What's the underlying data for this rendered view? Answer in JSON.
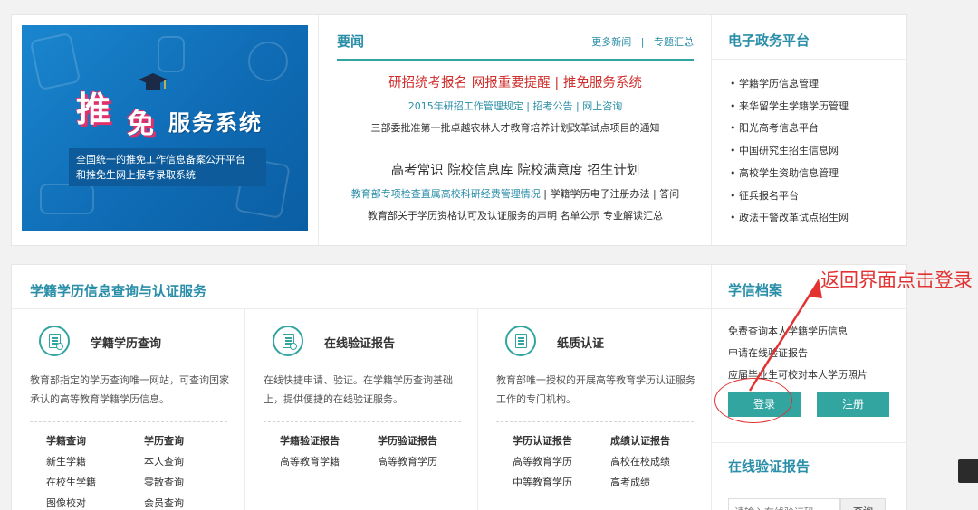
{
  "banner": {
    "title_tui": "推",
    "title_mian": "免",
    "title_system": "服务系统",
    "desc_line1": "全国统一的推免工作信息备案公开平台",
    "desc_line2": "和推免生网上报考录取系统"
  },
  "news": {
    "title": "要闻",
    "more_news": "更多新闻",
    "separator": "|",
    "topics": "专题汇总",
    "headline1": "研招统考报名  网报重要提醒 | 推免服务系统",
    "subline1": "2015年研招工作管理规定 | 招考公告 | 网上咨询",
    "subline2": "三部委批准第一批卓越农林人才教育培养计划改革试点项目的通知",
    "headline2": "高考常识  院校信息库  院校满意度  招生计划",
    "subline3_blue": "教育部专项检查直属高校科研经费管理情况",
    "subline3_rest": " | 学籍学历电子注册办法 | 答问",
    "subline4": "教育部关于学历资格认可及认证服务的声明  名单公示  专业解读汇总"
  },
  "platform": {
    "title": "电子政务平台",
    "items": [
      "学籍学历信息管理",
      "来华留学生学籍学历管理",
      "阳光高考信息平台",
      "中国研究生招生信息网",
      "高校学生资助信息管理",
      "征兵报名平台",
      "政法干警改革试点招生网"
    ]
  },
  "services": {
    "title": "学籍学历信息查询与认证服务",
    "columns": [
      {
        "title": "学籍学历查询",
        "desc": "教育部指定的学历查询唯一网站，可查询国家承认的高等教育学籍学历信息。",
        "links": [
          "学籍查询",
          "学历查询",
          "新生学籍",
          "本人查询",
          "在校生学籍",
          "零散查询",
          "图像校对",
          "会员查询"
        ]
      },
      {
        "title": "在线验证报告",
        "desc": "在线快捷申请、验证。在学籍学历查询基础上，提供便捷的在线验证服务。",
        "links": [
          "学籍验证报告",
          "学历验证报告",
          "高等教育学籍",
          "高等教育学历"
        ]
      },
      {
        "title": "纸质认证",
        "desc": "教育部唯一授权的开展高等教育学历认证服务工作的专门机构。",
        "links": [
          "学历认证报告",
          "成绩认证报告",
          "高等教育学历",
          "高校在校成绩",
          "中等教育学历",
          "高考成绩"
        ]
      }
    ]
  },
  "archive": {
    "title": "学信档案",
    "items": [
      "免费查询本人学籍学历信息",
      "申请在线验证报告",
      "应届毕业生可校对本人学历照片"
    ],
    "login": "登录",
    "register": "注册",
    "verify_title": "在线验证报告",
    "verify_placeholder": "请输入在线验证码",
    "verify_button": "查询"
  },
  "annotation": {
    "text": "返回界面点击登录",
    "color": "#e23232"
  },
  "colors": {
    "accent": "#2a8ea8",
    "teal": "#32a5a1",
    "headline_red": "#d0302e"
  }
}
